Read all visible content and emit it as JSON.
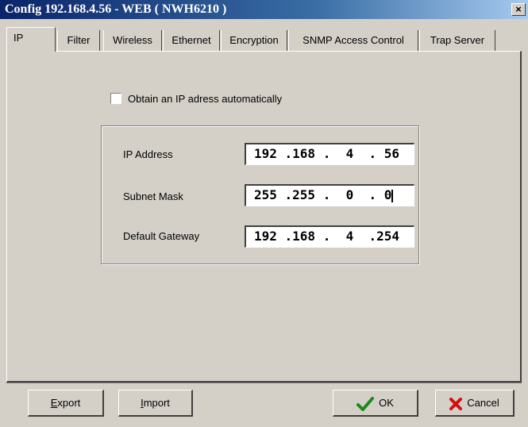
{
  "window": {
    "title": "Config 192.168.4.56 - WEB ( NWH6210 )",
    "close_label": "×"
  },
  "tabs": [
    {
      "label": "IP",
      "active": true
    },
    {
      "label": "Filter"
    },
    {
      "label": "Wireless"
    },
    {
      "label": "Ethernet"
    },
    {
      "label": "Encryption"
    },
    {
      "label": "SNMP Access Control"
    },
    {
      "label": "Trap Server"
    }
  ],
  "auto_ip": {
    "label": "Obtain an IP adress automatically",
    "checked": false
  },
  "fields": {
    "ip_address": {
      "label": "IP Address",
      "value": "192 .168 .  4  . 56"
    },
    "subnet_mask": {
      "label": "Subnet Mask",
      "value": "255 .255 .  0  . 0"
    },
    "gateway": {
      "label": "Default Gateway",
      "value": "192 .168 .  4  .254"
    }
  },
  "buttons": {
    "export": {
      "accel": "E",
      "rest": "xport"
    },
    "import": {
      "accel": "I",
      "rest": "mport"
    },
    "ok": {
      "label": "OK",
      "icon": "checkmark-icon"
    },
    "cancel": {
      "label": "Cancel",
      "icon": "x-mark-icon"
    }
  },
  "colors": {
    "titlebar_start": "#0a246a",
    "face": "#d4d0c8",
    "ok_check": "#1a8a1a",
    "cancel_x": "#d01010"
  }
}
